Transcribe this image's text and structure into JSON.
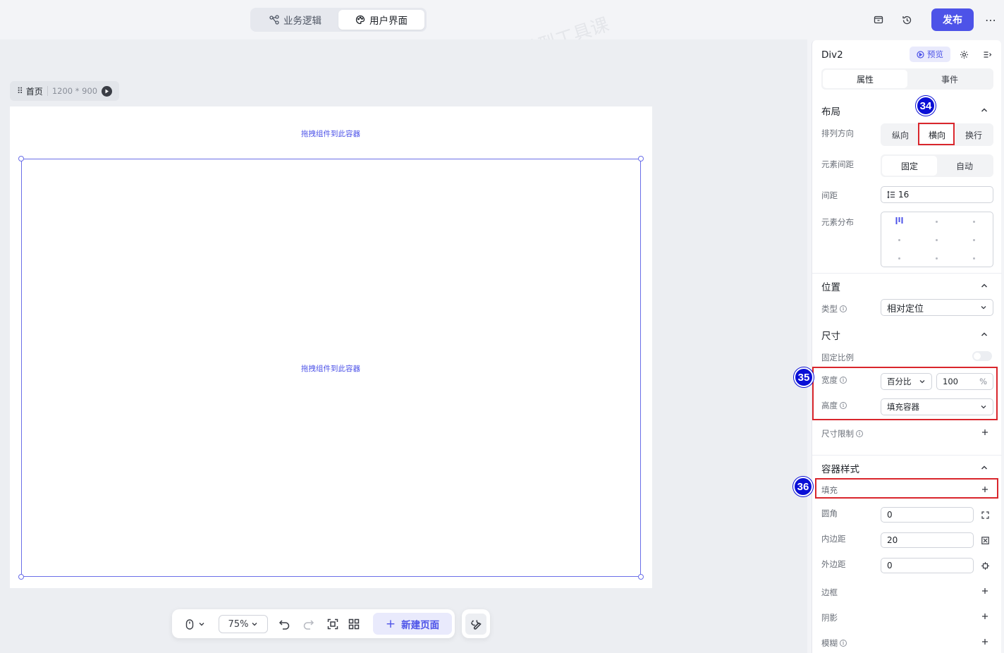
{
  "topbar": {
    "tabs": [
      {
        "label": "业务逻辑",
        "icon": "flow-icon",
        "active": false
      },
      {
        "label": "用户界面",
        "icon": "palette-icon",
        "active": true
      }
    ],
    "publish_label": "发布"
  },
  "canvas": {
    "page_name": "首页",
    "page_size": "1200 * 900",
    "drop_hint_top": "拖拽组件到此容器",
    "drop_hint_inner": "拖拽组件到此容器"
  },
  "toolbar": {
    "zoom": "75%",
    "new_page_label": "新建页面"
  },
  "panel": {
    "title": "Div2",
    "preview_label": "预览",
    "tabs": [
      "属性",
      "事件"
    ],
    "layout": {
      "title": "布局",
      "direction_label": "排列方向",
      "direction_options": [
        "纵向",
        "横向",
        "换行"
      ],
      "spacing_mode_label": "元素间距",
      "spacing_mode_options": [
        "固定",
        "自动"
      ],
      "gap_label": "间距",
      "gap_value": "16",
      "distribution_label": "元素分布"
    },
    "position": {
      "title": "位置",
      "type_label": "类型",
      "type_value": "相对定位"
    },
    "size": {
      "title": "尺寸",
      "ratio_label": "固定比例",
      "width_label": "宽度",
      "width_unit_mode": "百分比",
      "width_value": "100",
      "width_unit": "%",
      "height_label": "高度",
      "height_value": "填充容器",
      "limit_label": "尺寸限制"
    },
    "container": {
      "title": "容器样式",
      "fill_label": "填充",
      "radius_label": "圆角",
      "radius_value": "0",
      "padding_label": "内边距",
      "padding_value": "20",
      "margin_label": "外边距",
      "margin_value": "0",
      "border_label": "边框",
      "shadow_label": "阴影",
      "blur_label": "模糊"
    }
  },
  "annotations": [
    "34",
    "35",
    "36"
  ],
  "watermark": "吴百豹-AI大模型工具课",
  "colors": {
    "accent": "#4d53e8",
    "annotation_badge": "#0a0fd6",
    "annotation_box": "#d9262c"
  }
}
